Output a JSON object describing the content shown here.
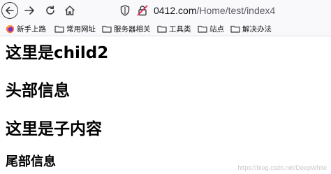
{
  "browser": {
    "url_host": "0412.com",
    "url_path": "/Home/test/index4",
    "icons": {
      "back": "back-arrow-icon",
      "forward": "forward-arrow-icon",
      "reload": "reload-icon",
      "home": "home-icon",
      "tracking": "shield-icon",
      "connection": "insecure-lock-icon"
    }
  },
  "bookmarks": [
    {
      "label": "新手上路",
      "icon": "firefox-icon"
    },
    {
      "label": "常用网址",
      "icon": "folder-icon"
    },
    {
      "label": "服务器相关",
      "icon": "folder-icon"
    },
    {
      "label": "工具类",
      "icon": "folder-icon"
    },
    {
      "label": "站点",
      "icon": "folder-icon"
    },
    {
      "label": "解决办法",
      "icon": "folder-icon"
    }
  ],
  "page": {
    "heading_child": "这里是child2",
    "heading_header": "头部信息",
    "heading_content": "这里是子内容",
    "heading_footer": "尾部信息"
  },
  "watermark": "https://blog.csdn.net/DeepWhite"
}
